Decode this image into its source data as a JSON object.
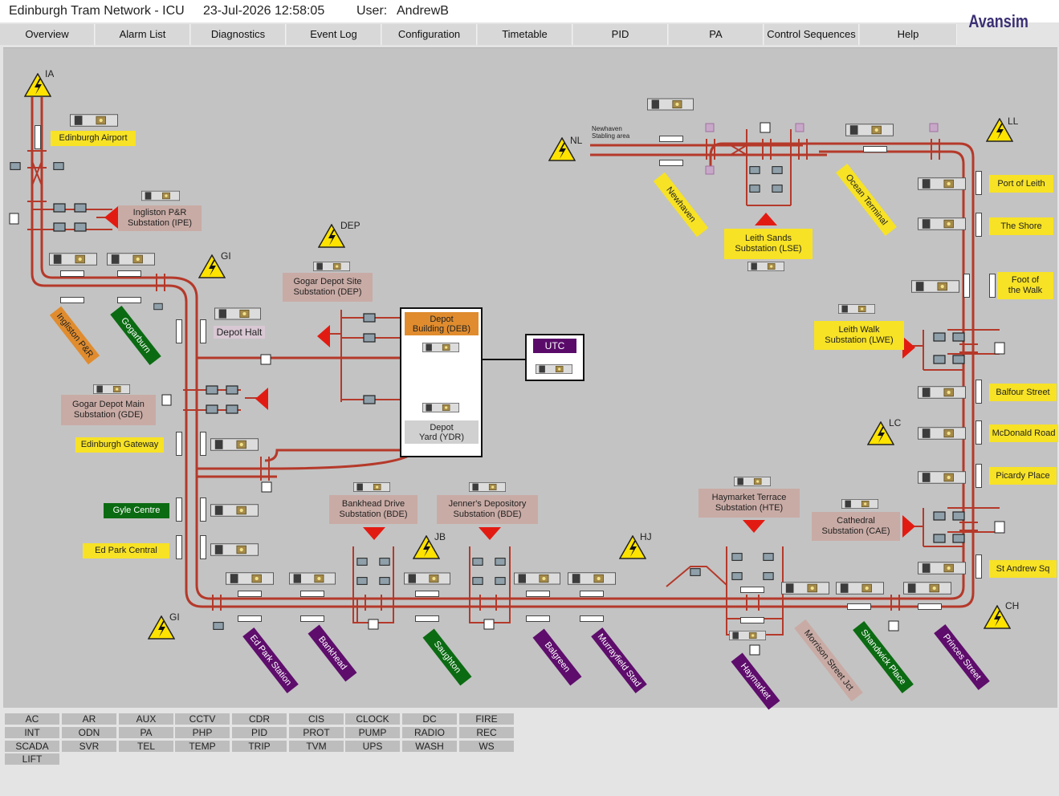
{
  "header": {
    "title": "Edinburgh Tram Network - ICU",
    "datetime": "23-Jul-2026 12:58:05",
    "user_label": "User:",
    "user_name": "AndrewB",
    "logo": "Avansim"
  },
  "menu": [
    "Overview",
    "Alarm List",
    "Diagnostics",
    "Event Log",
    "Configuration",
    "Timetable",
    "PID",
    "PA",
    "Control Sequences",
    "Help"
  ],
  "colors": {
    "track": "#b5392a",
    "panel": "#c3c3c3",
    "station_yellow": "#f7e225",
    "station_green": "#0b6b12",
    "station_purple": "#5e0d6c",
    "station_orange": "#e08c2e",
    "substation_pink": "#c9aba5",
    "alarm_red": "#e21b12",
    "warning_yellow": "#ffe300",
    "utc_purple": "#5a0b6a"
  },
  "zones": [
    {
      "label": "IA"
    },
    {
      "label": "DEP"
    },
    {
      "label": "GI"
    },
    {
      "label": "NL"
    },
    {
      "label": "LL"
    },
    {
      "label": "LC"
    },
    {
      "label": "JB"
    },
    {
      "label": "HJ"
    },
    {
      "label": "GI"
    },
    {
      "label": "CH"
    }
  ],
  "stop_labels": {
    "edinburgh_airport": "Edinburgh Airport",
    "depot_halt": "Depot Halt",
    "edinburgh_gateway": "Edinburgh Gateway",
    "gyle_centre": "Gyle Centre",
    "ed_park_central": "Ed Park Central",
    "ingliston_pr": "Ingliston P&R",
    "gogarburn": "Gogarburn",
    "ed_park_station": "Ed Park Station",
    "bankhead": "Bankhead",
    "saughton": "Saughton",
    "balgreen": "Balgreen",
    "murrayfield": "Murrayfield Stad",
    "haymarket": "Haymarket",
    "morrison": "Morrison Street Jct",
    "shandwick": "Shandwick Place",
    "princes": "Princes Street",
    "newhaven": "Newhaven",
    "ocean_terminal": "Ocean Terminal",
    "port_of_leith": "Port of Leith",
    "the_shore": "The Shore",
    "foot_of_walk": "Foot of\nthe Walk",
    "balfour": "Balfour Street",
    "mcdonald": "McDonald Road",
    "picardy": "Picardy Place",
    "st_andrew": "St Andrew Sq",
    "newhaven_stabling": "Newhaven\nStabling area"
  },
  "substations": {
    "ipe": "Ingliston P&R\nSubstation (IPE)",
    "dep": "Gogar Depot Site\nSubstation (DEP)",
    "gde": "Gogar Depot Main\nSubstation (GDE)",
    "deb": "Depot\nBuilding (DEB)",
    "ydr": "Depot\nYard (YDR)",
    "utc": "UTC",
    "bde1": "Bankhead Drive\nSubstation (BDE)",
    "bde2": "Jenner's Depository\nSubstation (BDE)",
    "hte": "Haymarket Terrace\nSubstation (HTE)",
    "cae": "Cathedral\nSubstation (CAE)",
    "lse": "Leith Sands\nSubstation (LSE)",
    "lwe": "Leith Walk\nSubstation (LWE)"
  },
  "systems": [
    "AC",
    "AR",
    "AUX",
    "CCTV",
    "CDR",
    "CIS",
    "CLOCK",
    "DC",
    "FIRE",
    "INT",
    "ODN",
    "PA",
    "PHP",
    "PID",
    "PROT",
    "PUMP",
    "RADIO",
    "REC",
    "SCADA",
    "SVR",
    "TEL",
    "TEMP",
    "TRIP",
    "TVM",
    "UPS",
    "WASH",
    "WS",
    "LIFT"
  ]
}
